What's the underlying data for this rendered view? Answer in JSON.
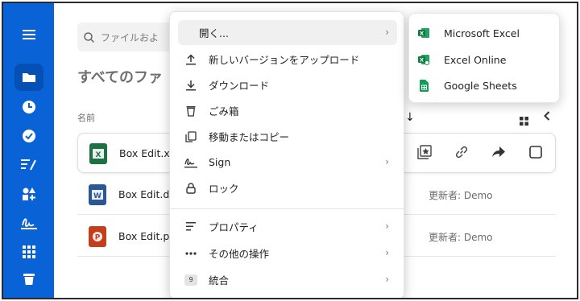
{
  "search": {
    "placeholder": "ファイルおよ"
  },
  "main": {
    "heading": "すべてのファ",
    "column_name": "名前",
    "sort_arrow": "↓"
  },
  "files": [
    {
      "name": "Box Edit.xls",
      "type": "excel",
      "updater": ""
    },
    {
      "name": "Box Edit.do",
      "type": "word",
      "updater": "更新者: Demo"
    },
    {
      "name": "Box Edit.pp",
      "type": "powerpoint",
      "updater": "更新者: Demo"
    }
  ],
  "context_menu": {
    "items": [
      {
        "label": "開く...",
        "icon": "open-icon",
        "submenu": true
      },
      {
        "label": "新しいバージョンをアップロード",
        "icon": "upload-icon",
        "submenu": false
      },
      {
        "label": "ダウンロード",
        "icon": "download-icon",
        "submenu": false
      },
      {
        "label": "ごみ箱",
        "icon": "trash-icon",
        "submenu": false
      },
      {
        "label": "移動またはコピー",
        "icon": "copy-icon",
        "submenu": false
      },
      {
        "label": "Sign",
        "icon": "sign-icon",
        "submenu": true
      },
      {
        "label": "ロック",
        "icon": "lock-icon",
        "submenu": false
      },
      {
        "label": "プロパティ",
        "icon": "properties-icon",
        "submenu": true
      },
      {
        "label": "その他の操作",
        "icon": "more-icon",
        "submenu": true
      },
      {
        "label": "統合",
        "icon": "integration-icon",
        "submenu": true
      }
    ],
    "integration_badge": "9",
    "chevron": "›"
  },
  "open_submenu": {
    "items": [
      {
        "label": "Microsoft Excel",
        "icon": "microsoft-excel-icon"
      },
      {
        "label": "Excel Online",
        "icon": "excel-online-icon"
      },
      {
        "label": "Google Sheets",
        "icon": "google-sheets-icon"
      }
    ]
  },
  "colors": {
    "sidebar": "#0a63d6",
    "excel": "#1e7145",
    "word": "#2b5797",
    "powerpoint": "#c43e1c",
    "sheets": "#0f9d58"
  }
}
